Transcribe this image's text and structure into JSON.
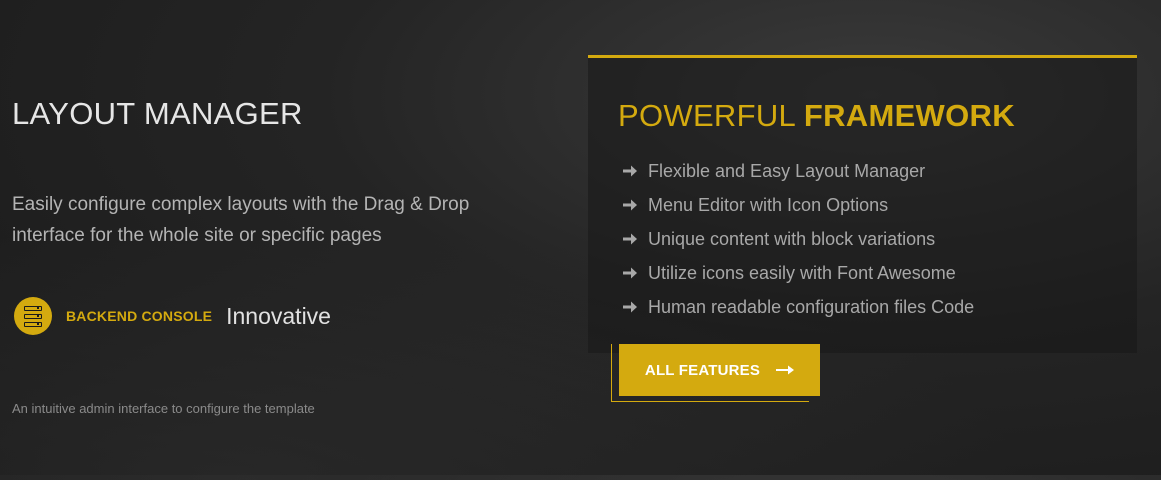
{
  "left": {
    "title": "LAYOUT MANAGER",
    "description": "Easily configure complex layouts with the Drag & Drop interface for the whole site or specific pages",
    "console_label": "BACKEND CONSOLE",
    "console_value": "Innovative",
    "footnote": "An intuitive admin interface to configure the template"
  },
  "panel": {
    "title_light": "POWERFUL ",
    "title_bold": "FRAMEWORK",
    "features": [
      "Flexible and Easy Layout Manager",
      "Menu Editor with Icon Options",
      "Unique content with block variations",
      "Utilize icons easily with Font Awesome",
      "Human readable configuration files Code"
    ],
    "button_label": "ALL FEATURES"
  },
  "colors": {
    "accent": "#d4aa0f",
    "background": "#242424",
    "text_light": "#e6e6e6",
    "text_muted": "#a8a8a8"
  },
  "icons": {
    "console": "server-icon",
    "feature_bullet": "arrow-right-icon",
    "button": "long-arrow-right-icon"
  }
}
